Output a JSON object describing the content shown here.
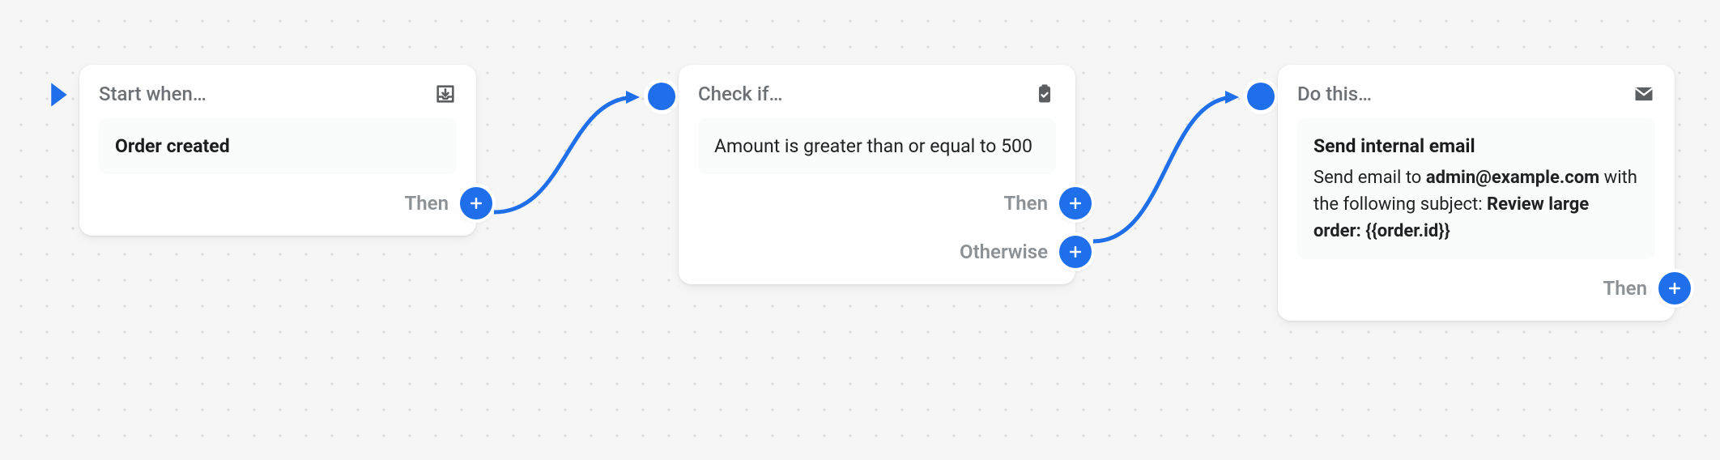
{
  "colors": {
    "accent": "#1f6feb"
  },
  "nodes": {
    "start": {
      "header": "Start when…",
      "icon": "inbox-download-icon",
      "body": "Order created",
      "outlets": [
        {
          "label": "Then"
        }
      ]
    },
    "condition": {
      "header": "Check if…",
      "icon": "clipboard-check-icon",
      "body": "Amount is greater than or equal to 500",
      "outlets": [
        {
          "label": "Then"
        },
        {
          "label": "Otherwise"
        }
      ]
    },
    "action": {
      "header": "Do this…",
      "icon": "mail-icon",
      "title": "Send internal email",
      "desc_prefix": "Send email to ",
      "email": "admin@example.com",
      "desc_middle": " with the following subject: ",
      "subject": "Review large order: {{order.id}}",
      "outlets": [
        {
          "label": "Then"
        }
      ]
    }
  }
}
